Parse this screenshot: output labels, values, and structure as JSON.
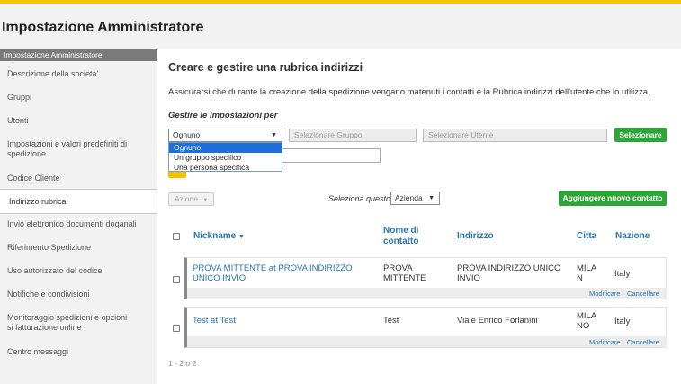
{
  "page": {
    "title": "Impostazione Amministratore"
  },
  "sidebar": {
    "header": "Impostazione Amministratore",
    "items": [
      {
        "label": "Descrizione della societa'"
      },
      {
        "label": "Gruppi"
      },
      {
        "label": "Utenti"
      },
      {
        "label": "Impostazioni e valori predefiniti di spedizione"
      },
      {
        "label": "Codice Cliente"
      },
      {
        "label": "Indirizzo rubrica"
      },
      {
        "label": "Invio elettronico documenti doganali"
      },
      {
        "label": "Riferimento Spedizione"
      },
      {
        "label": "Uso autorizzato del codice"
      },
      {
        "label": "Notifiche e condivisioni"
      },
      {
        "label": "Monitoraggio spedizioni e opzioni si fatturazione online"
      },
      {
        "label": "Centro messaggi"
      }
    ]
  },
  "main": {
    "heading": "Creare e gestire una rubrica indirizzi",
    "description": "Assicurarsi che durante la creazione della spedizione vengano matenuti i contatti e la Rubrica indirizzi dell'utente che lo utilizza.",
    "gestire_label": "Gestire le impostazioni per",
    "scope_select": {
      "value": "Ognuno",
      "options": [
        "Ognuno",
        "Un gruppo specifico",
        "Una persona specifica"
      ]
    },
    "group_placeholder": "Selezionare Gruppo",
    "user_placeholder": "Selezionare Utente",
    "select_button": "Selezionare",
    "azione_label": "Azione",
    "seleziona_label": "Seleziona questo",
    "seleziona_value": "Azienda",
    "add_contact_button": "Aggiungere nuovo contatto"
  },
  "table": {
    "headers": {
      "nickname": "Nickname",
      "nome": "Nome di contatto",
      "indirizzo": "Indirizzo",
      "citta": "Citta",
      "nazione": "Nazione"
    },
    "rows": [
      {
        "nickname": "PROVA MITTENTE at PROVA INDIRIZZO UNICO INVIO",
        "nome": "PROVA MITTENTE",
        "indirizzo": "PROVA INDIRIZZO UNICO INVIO",
        "citta": "MILA N",
        "nazione": "Italy",
        "edit": "Modificare",
        "delete": "Cancellare"
      },
      {
        "nickname": "Test at Test",
        "nome": "Test",
        "indirizzo": "Viale Enrico Forlanini",
        "citta": "MILA NO",
        "nazione": "Italy",
        "edit": "Modificare",
        "delete": "Cancellare"
      }
    ],
    "pager": "1 - 2 o 2"
  },
  "colors": {
    "accent": "#f7c600",
    "link": "#2577b5",
    "green": "#2fa43a",
    "dropdown_highlight": "#1e6fd9"
  },
  "icons": {
    "sort": "triangle-down",
    "select_arrow": "triangle-down"
  }
}
